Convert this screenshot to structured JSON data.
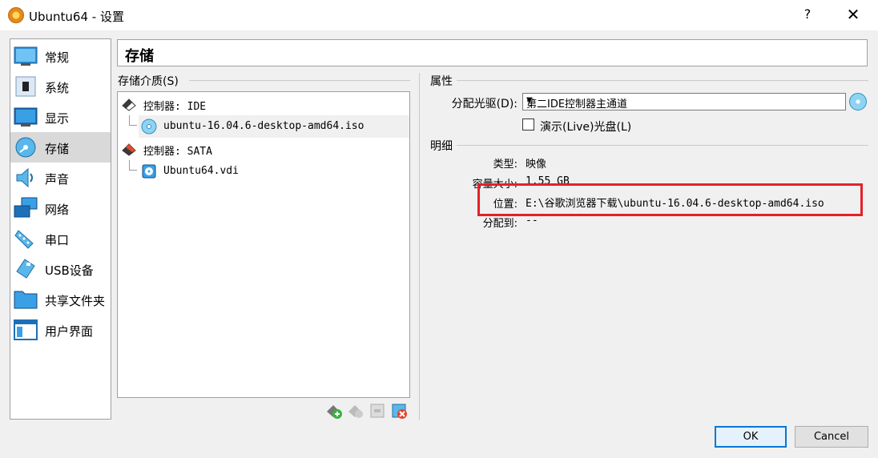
{
  "window": {
    "title": "Ubuntu64 - 设置",
    "help_label": "?",
    "close_label": "✕"
  },
  "sidebar": {
    "items": [
      {
        "label": "常规",
        "icon": "general-icon"
      },
      {
        "label": "系统",
        "icon": "system-icon"
      },
      {
        "label": "显示",
        "icon": "display-icon"
      },
      {
        "label": "存储",
        "icon": "storage-icon",
        "active": true
      },
      {
        "label": "声音",
        "icon": "audio-icon"
      },
      {
        "label": "网络",
        "icon": "network-icon"
      },
      {
        "label": "串口",
        "icon": "serial-port-icon"
      },
      {
        "label": "USB设备",
        "icon": "usb-icon"
      },
      {
        "label": "共享文件夹",
        "icon": "shared-folder-icon"
      },
      {
        "label": "用户界面",
        "icon": "user-interface-icon"
      }
    ]
  },
  "page": {
    "title": "存储"
  },
  "storage": {
    "group_label": "存储介质(S)",
    "tree": [
      {
        "label": "控制器: IDE",
        "type": "controller"
      },
      {
        "label": "ubuntu-16.04.6-desktop-amd64.iso",
        "type": "optical",
        "selected": true
      },
      {
        "label": "控制器: SATA",
        "type": "controller"
      },
      {
        "label": "Ubuntu64.vdi",
        "type": "disk"
      }
    ],
    "toolbar": [
      "add-controller-icon",
      "add-attachment-icon",
      "remove-attachment-icon",
      "remove-controller-icon"
    ]
  },
  "attributes": {
    "group_label": "属性",
    "drive_label": "分配光驱(D):",
    "drive_value": "第二IDE控制器主通道",
    "live_cd_label": "演示(Live)光盘(L)",
    "live_cd_checked": false
  },
  "details": {
    "group_label": "明细",
    "rows": [
      {
        "label": "类型:",
        "value": "映像"
      },
      {
        "label": "容量大小:",
        "value": "1.55 GB"
      },
      {
        "label": "位置:",
        "value": "E:\\谷歌浏览器下载\\ubuntu-16.04.6-desktop-amd64.iso"
      },
      {
        "label": "分配到:",
        "value": "--"
      }
    ]
  },
  "buttons": {
    "ok": "OK",
    "cancel": "Cancel"
  },
  "colors": {
    "highlight": "#e5202a",
    "selection": "#d9d9d9"
  }
}
